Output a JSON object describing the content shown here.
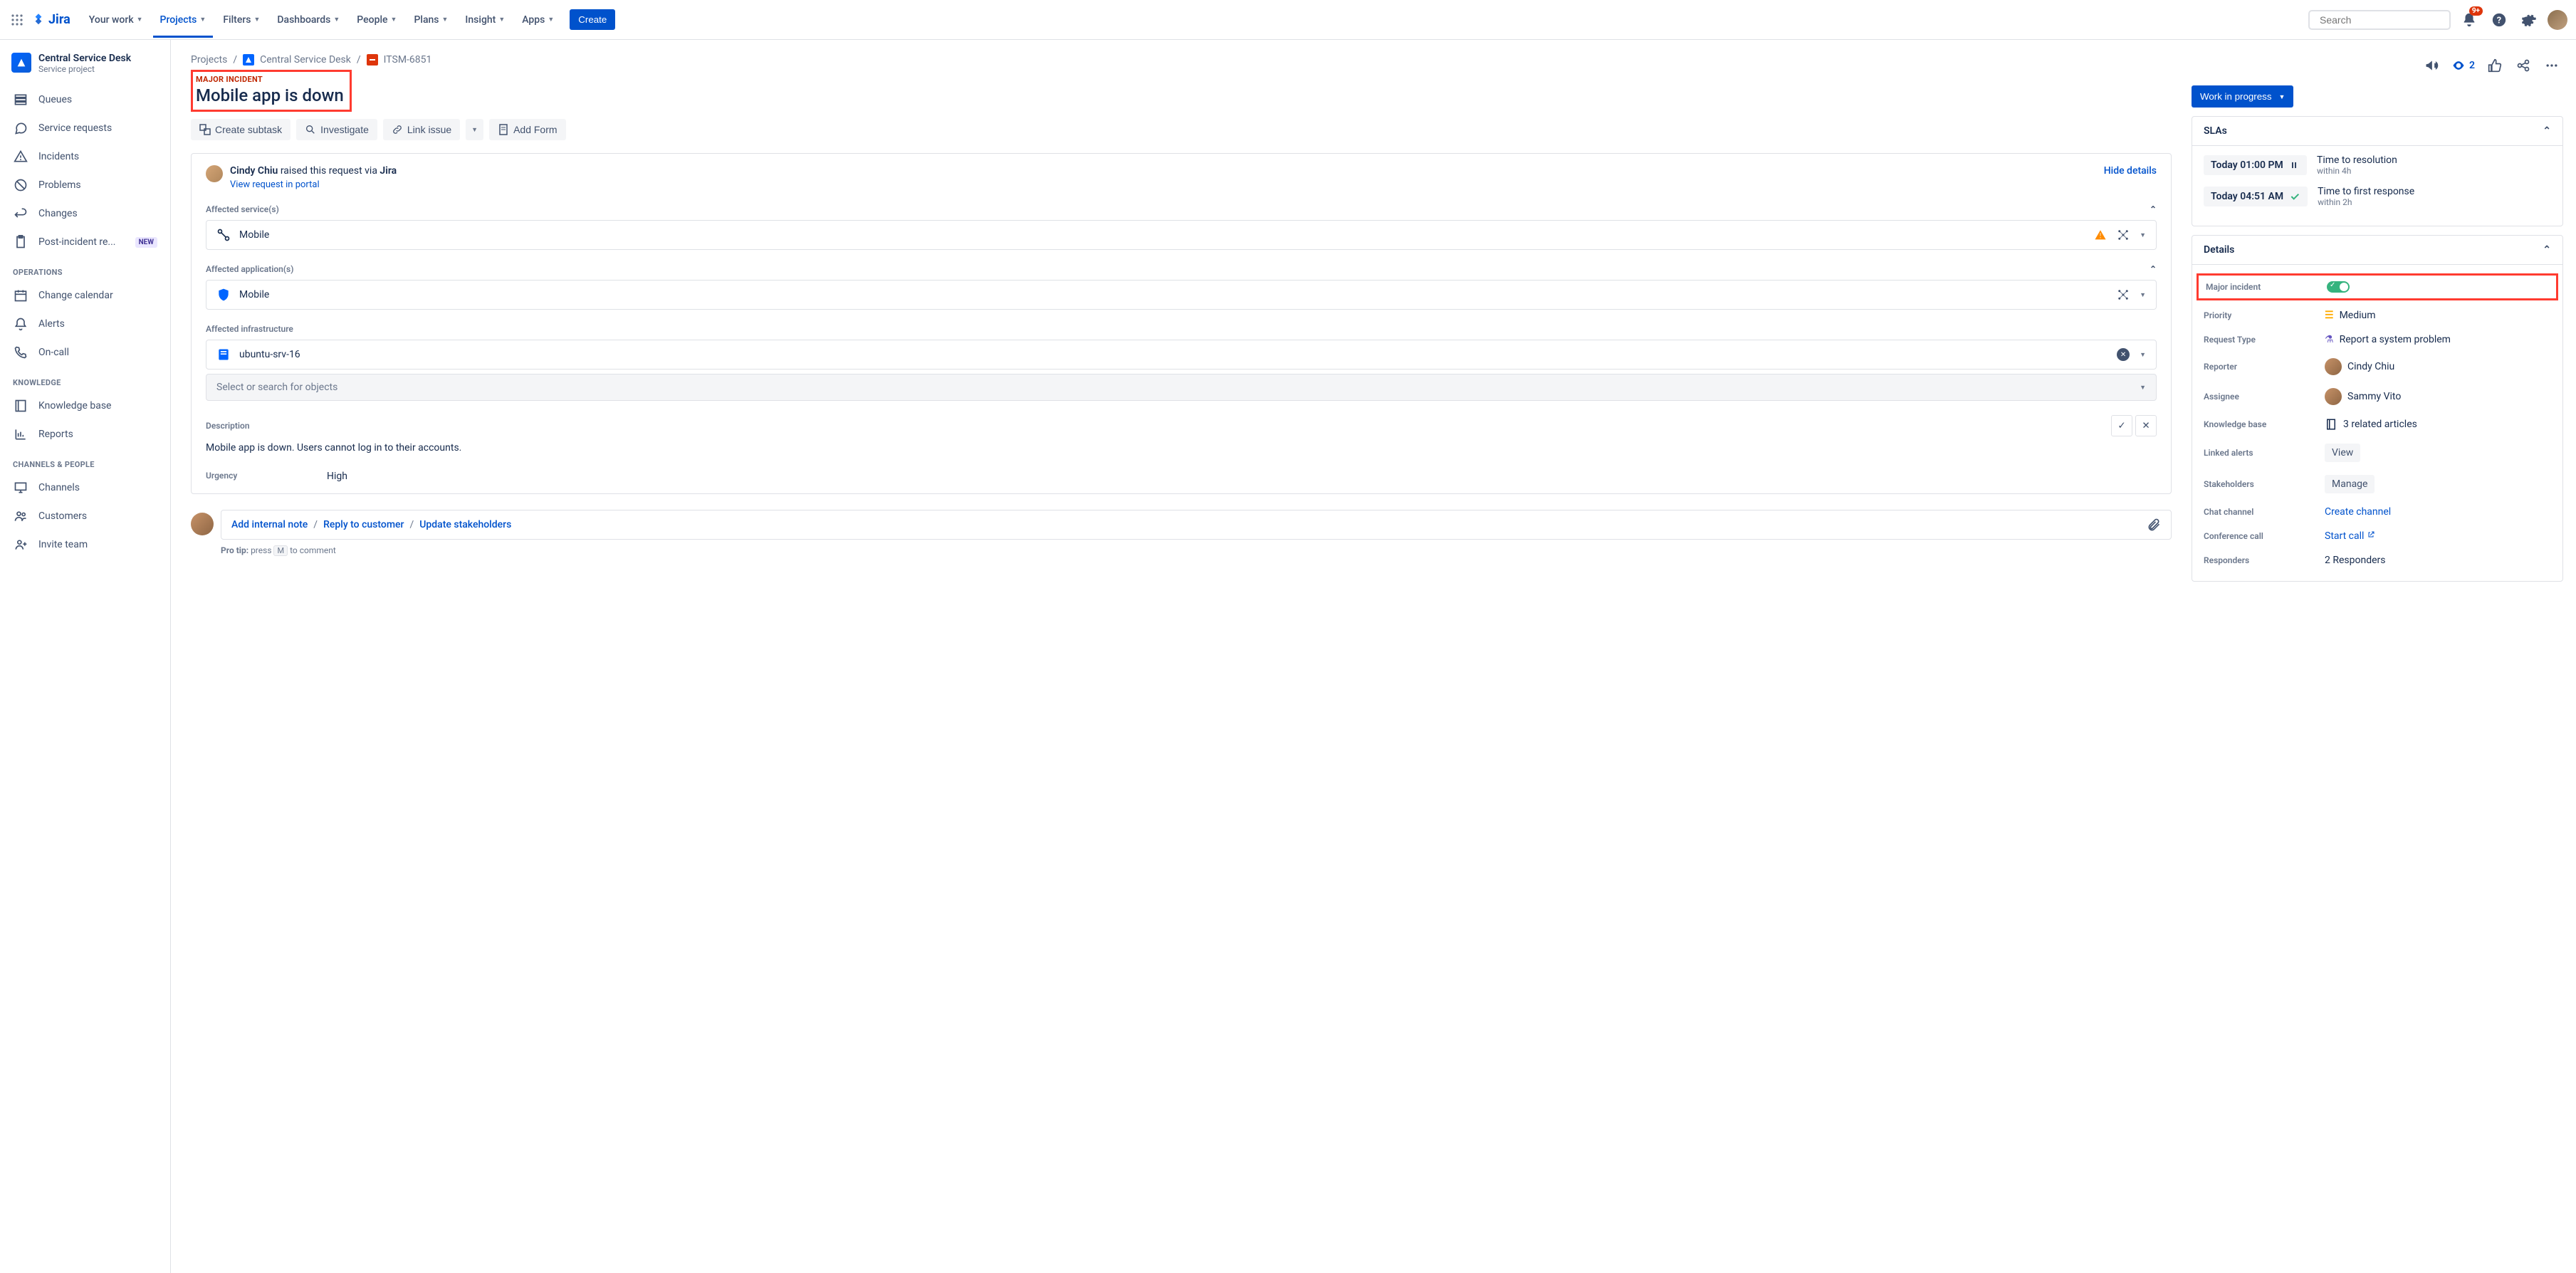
{
  "topnav": {
    "logo": "Jira",
    "items": [
      "Your work",
      "Projects",
      "Filters",
      "Dashboards",
      "People",
      "Plans",
      "Insight",
      "Apps"
    ],
    "active_index": 1,
    "create": "Create",
    "search_placeholder": "Search",
    "notification_badge": "9+"
  },
  "sidebar": {
    "project_title": "Central Service Desk",
    "project_subtitle": "Service project",
    "items_top": [
      {
        "label": "Queues",
        "icon": "queue"
      },
      {
        "label": "Service requests",
        "icon": "chat"
      },
      {
        "label": "Incidents",
        "icon": "warning"
      },
      {
        "label": "Problems",
        "icon": "block"
      },
      {
        "label": "Changes",
        "icon": "swap"
      },
      {
        "label": "Post-incident re...",
        "icon": "clipboard",
        "badge": "NEW"
      }
    ],
    "section_ops": "OPERATIONS",
    "items_ops": [
      {
        "label": "Change calendar",
        "icon": "calendar"
      },
      {
        "label": "Alerts",
        "icon": "bell"
      },
      {
        "label": "On-call",
        "icon": "phone"
      }
    ],
    "section_knowledge": "KNOWLEDGE",
    "items_knowledge": [
      {
        "label": "Knowledge base",
        "icon": "book"
      },
      {
        "label": "Reports",
        "icon": "chart"
      }
    ],
    "section_channels": "CHANNELS & PEOPLE",
    "items_channels": [
      {
        "label": "Channels",
        "icon": "monitor"
      },
      {
        "label": "Customers",
        "icon": "group"
      },
      {
        "label": "Invite team",
        "icon": "person-add"
      }
    ]
  },
  "breadcrumb": {
    "projects": "Projects",
    "project": "Central Service Desk",
    "key": "ITSM-6851"
  },
  "issue": {
    "tag": "MAJOR INCIDENT",
    "title": "Mobile app is down"
  },
  "toolbar": {
    "create_subtask": "Create subtask",
    "investigate": "Investigate",
    "link_issue": "Link issue",
    "add_form": "Add Form"
  },
  "request": {
    "reporter": "Cindy Chiu",
    "text_mid": " raised this request via ",
    "via": "Jira",
    "portal_link": "View request in portal",
    "hide_details": "Hide details"
  },
  "fields": {
    "affected_services_label": "Affected service(s)",
    "affected_services_value": "Mobile",
    "affected_apps_label": "Affected application(s)",
    "affected_apps_value": "Mobile",
    "affected_infra_label": "Affected infrastructure",
    "affected_infra_value": "ubuntu-srv-16",
    "search_placeholder": "Select or search for objects",
    "description_label": "Description",
    "description_text": "Mobile app is down. Users cannot log in to their accounts.",
    "urgency_label": "Urgency",
    "urgency_value": "High"
  },
  "comment": {
    "internal": "Add internal note",
    "reply": "Reply to customer",
    "stakeholders": "Update stakeholders",
    "protip_pre": "Pro tip: ",
    "protip_press": "press ",
    "protip_key": "M",
    "protip_post": " to comment"
  },
  "right_actions": {
    "watch_count": "2"
  },
  "status": "Work in progress",
  "slas": {
    "heading": "SLAs",
    "rows": [
      {
        "time": "Today 01:00 PM",
        "icon": "pause",
        "label": "Time to resolution",
        "sub": "within 4h"
      },
      {
        "time": "Today 04:51 AM",
        "icon": "check",
        "label": "Time to first response",
        "sub": "within 2h"
      }
    ]
  },
  "details": {
    "heading": "Details",
    "rows": {
      "major_incident": {
        "key": "Major incident"
      },
      "priority": {
        "key": "Priority",
        "val": "Medium"
      },
      "request_type": {
        "key": "Request Type",
        "val": "Report a system problem"
      },
      "reporter": {
        "key": "Reporter",
        "val": "Cindy Chiu"
      },
      "assignee": {
        "key": "Assignee",
        "val": "Sammy Vito"
      },
      "knowledge_base": {
        "key": "Knowledge base",
        "val": "3 related articles"
      },
      "linked_alerts": {
        "key": "Linked alerts",
        "val": "View"
      },
      "stakeholders": {
        "key": "Stakeholders",
        "val": "Manage"
      },
      "chat_channel": {
        "key": "Chat channel",
        "val": "Create channel"
      },
      "conference_call": {
        "key": "Conference call",
        "val": "Start call"
      },
      "responders": {
        "key": "Responders",
        "val": "2 Responders"
      }
    }
  }
}
